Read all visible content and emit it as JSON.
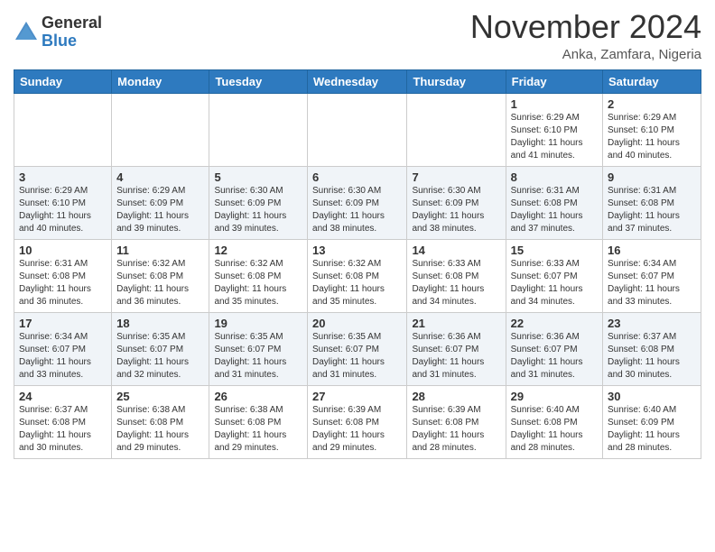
{
  "header": {
    "logo_general": "General",
    "logo_blue": "Blue",
    "month_title": "November 2024",
    "location": "Anka, Zamfara, Nigeria"
  },
  "weekdays": [
    "Sunday",
    "Monday",
    "Tuesday",
    "Wednesday",
    "Thursday",
    "Friday",
    "Saturday"
  ],
  "weeks": [
    [
      {
        "day": "",
        "info": ""
      },
      {
        "day": "",
        "info": ""
      },
      {
        "day": "",
        "info": ""
      },
      {
        "day": "",
        "info": ""
      },
      {
        "day": "",
        "info": ""
      },
      {
        "day": "1",
        "info": "Sunrise: 6:29 AM\nSunset: 6:10 PM\nDaylight: 11 hours\nand 41 minutes."
      },
      {
        "day": "2",
        "info": "Sunrise: 6:29 AM\nSunset: 6:10 PM\nDaylight: 11 hours\nand 40 minutes."
      }
    ],
    [
      {
        "day": "3",
        "info": "Sunrise: 6:29 AM\nSunset: 6:10 PM\nDaylight: 11 hours\nand 40 minutes."
      },
      {
        "day": "4",
        "info": "Sunrise: 6:29 AM\nSunset: 6:09 PM\nDaylight: 11 hours\nand 39 minutes."
      },
      {
        "day": "5",
        "info": "Sunrise: 6:30 AM\nSunset: 6:09 PM\nDaylight: 11 hours\nand 39 minutes."
      },
      {
        "day": "6",
        "info": "Sunrise: 6:30 AM\nSunset: 6:09 PM\nDaylight: 11 hours\nand 38 minutes."
      },
      {
        "day": "7",
        "info": "Sunrise: 6:30 AM\nSunset: 6:09 PM\nDaylight: 11 hours\nand 38 minutes."
      },
      {
        "day": "8",
        "info": "Sunrise: 6:31 AM\nSunset: 6:08 PM\nDaylight: 11 hours\nand 37 minutes."
      },
      {
        "day": "9",
        "info": "Sunrise: 6:31 AM\nSunset: 6:08 PM\nDaylight: 11 hours\nand 37 minutes."
      }
    ],
    [
      {
        "day": "10",
        "info": "Sunrise: 6:31 AM\nSunset: 6:08 PM\nDaylight: 11 hours\nand 36 minutes."
      },
      {
        "day": "11",
        "info": "Sunrise: 6:32 AM\nSunset: 6:08 PM\nDaylight: 11 hours\nand 36 minutes."
      },
      {
        "day": "12",
        "info": "Sunrise: 6:32 AM\nSunset: 6:08 PM\nDaylight: 11 hours\nand 35 minutes."
      },
      {
        "day": "13",
        "info": "Sunrise: 6:32 AM\nSunset: 6:08 PM\nDaylight: 11 hours\nand 35 minutes."
      },
      {
        "day": "14",
        "info": "Sunrise: 6:33 AM\nSunset: 6:08 PM\nDaylight: 11 hours\nand 34 minutes."
      },
      {
        "day": "15",
        "info": "Sunrise: 6:33 AM\nSunset: 6:07 PM\nDaylight: 11 hours\nand 34 minutes."
      },
      {
        "day": "16",
        "info": "Sunrise: 6:34 AM\nSunset: 6:07 PM\nDaylight: 11 hours\nand 33 minutes."
      }
    ],
    [
      {
        "day": "17",
        "info": "Sunrise: 6:34 AM\nSunset: 6:07 PM\nDaylight: 11 hours\nand 33 minutes."
      },
      {
        "day": "18",
        "info": "Sunrise: 6:35 AM\nSunset: 6:07 PM\nDaylight: 11 hours\nand 32 minutes."
      },
      {
        "day": "19",
        "info": "Sunrise: 6:35 AM\nSunset: 6:07 PM\nDaylight: 11 hours\nand 31 minutes."
      },
      {
        "day": "20",
        "info": "Sunrise: 6:35 AM\nSunset: 6:07 PM\nDaylight: 11 hours\nand 31 minutes."
      },
      {
        "day": "21",
        "info": "Sunrise: 6:36 AM\nSunset: 6:07 PM\nDaylight: 11 hours\nand 31 minutes."
      },
      {
        "day": "22",
        "info": "Sunrise: 6:36 AM\nSunset: 6:07 PM\nDaylight: 11 hours\nand 31 minutes."
      },
      {
        "day": "23",
        "info": "Sunrise: 6:37 AM\nSunset: 6:08 PM\nDaylight: 11 hours\nand 30 minutes."
      }
    ],
    [
      {
        "day": "24",
        "info": "Sunrise: 6:37 AM\nSunset: 6:08 PM\nDaylight: 11 hours\nand 30 minutes."
      },
      {
        "day": "25",
        "info": "Sunrise: 6:38 AM\nSunset: 6:08 PM\nDaylight: 11 hours\nand 29 minutes."
      },
      {
        "day": "26",
        "info": "Sunrise: 6:38 AM\nSunset: 6:08 PM\nDaylight: 11 hours\nand 29 minutes."
      },
      {
        "day": "27",
        "info": "Sunrise: 6:39 AM\nSunset: 6:08 PM\nDaylight: 11 hours\nand 29 minutes."
      },
      {
        "day": "28",
        "info": "Sunrise: 6:39 AM\nSunset: 6:08 PM\nDaylight: 11 hours\nand 28 minutes."
      },
      {
        "day": "29",
        "info": "Sunrise: 6:40 AM\nSunset: 6:08 PM\nDaylight: 11 hours\nand 28 minutes."
      },
      {
        "day": "30",
        "info": "Sunrise: 6:40 AM\nSunset: 6:09 PM\nDaylight: 11 hours\nand 28 minutes."
      }
    ]
  ]
}
